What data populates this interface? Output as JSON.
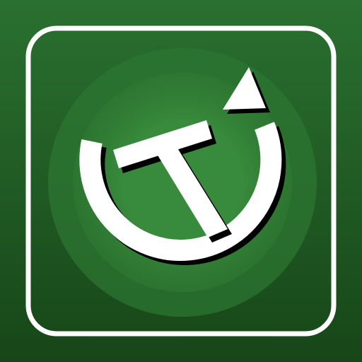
{
  "icon": {
    "name": "refresh-t-icon",
    "colors": {
      "background_top": "#2a7030",
      "background_bottom": "#174618",
      "frame_border": "#ffffff",
      "glow_outer": "#2f7a33",
      "glow_inner": "#3a8d3e",
      "symbol": "#ffffff",
      "shadow": "#000000"
    }
  }
}
